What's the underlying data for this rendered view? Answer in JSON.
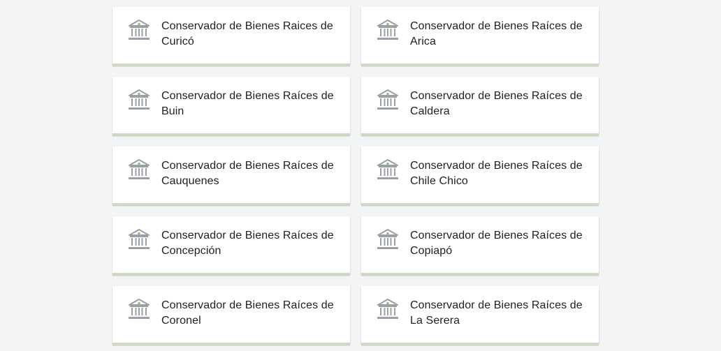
{
  "cards": [
    {
      "line1": "Conservador de Bienes Raices de",
      "line2": "Curicó",
      "icon": "building-icon"
    },
    {
      "line1": "Conservador de Bienes Raíces de",
      "line2": "Arica",
      "icon": "building-icon"
    },
    {
      "line1": "Conservador de Bienes Raíces de",
      "line2": "Buin",
      "icon": "building-icon"
    },
    {
      "line1": "Conservador de Bienes Raíces de",
      "line2": "Caldera",
      "icon": "building-icon"
    },
    {
      "line1": "Conservador de Bienes Raíces de",
      "line2": "Cauquenes",
      "icon": "building-icon"
    },
    {
      "line1": "Conservador de Bienes Raíces de",
      "line2": "Chile Chico",
      "icon": "building-icon"
    },
    {
      "line1": "Conservador de Bienes Raíces de",
      "line2": "Concepción",
      "icon": "building-icon"
    },
    {
      "line1": "Conservador de Bienes Raíces de",
      "line2": "Copiapó",
      "icon": "building-icon"
    },
    {
      "line1": "Conservador de Bienes Raíces de",
      "line2": "Coronel",
      "icon": "building-icon"
    },
    {
      "line1": "Conservador de Bienes Raíces de",
      "line2": "La Serera",
      "icon": "building-icon"
    }
  ],
  "colors": {
    "background": "#f3f4f6",
    "card": "#ffffff",
    "accent_green": "#8cc36b",
    "icon_gray": "#9aa0a6",
    "card_border": "#c9dfb4"
  }
}
